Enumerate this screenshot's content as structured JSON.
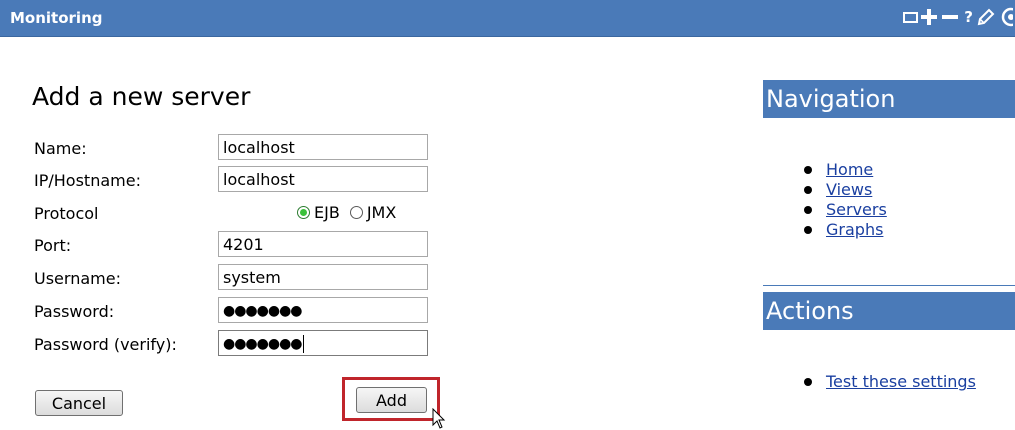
{
  "window": {
    "title": "Monitoring",
    "tools": [
      "restore-icon",
      "plus-icon",
      "minus-icon",
      "help-icon",
      "pencil-icon",
      "gear-icon"
    ],
    "help_label": "?"
  },
  "form": {
    "title": "Add a new server",
    "fields": {
      "name": {
        "label": "Name:",
        "value": "localhost"
      },
      "host": {
        "label": "IP/Hostname:",
        "value": "localhost"
      },
      "protocol": {
        "label": "Protocol",
        "options": [
          "EJB",
          "JMX"
        ],
        "selected": "EJB"
      },
      "port": {
        "label": "Port:",
        "value": "4201"
      },
      "username": {
        "label": "Username:",
        "value": "system"
      },
      "password": {
        "label": "Password:",
        "masked": "●●●●●●●"
      },
      "password_verify": {
        "label": "Password (verify):",
        "masked": "●●●●●●●"
      }
    },
    "buttons": {
      "cancel": "Cancel",
      "add": "Add"
    }
  },
  "sidebar": {
    "navigation": {
      "title": "Navigation",
      "items": [
        {
          "label": "Home"
        },
        {
          "label": "Views"
        },
        {
          "label": "Servers"
        },
        {
          "label": "Graphs"
        }
      ]
    },
    "actions": {
      "title": "Actions",
      "items": [
        {
          "label": "Test these settings"
        }
      ]
    }
  },
  "colors": {
    "titlebar": "#4a7ab8",
    "link": "#1a3fa0",
    "highlight": "#c0252b"
  }
}
